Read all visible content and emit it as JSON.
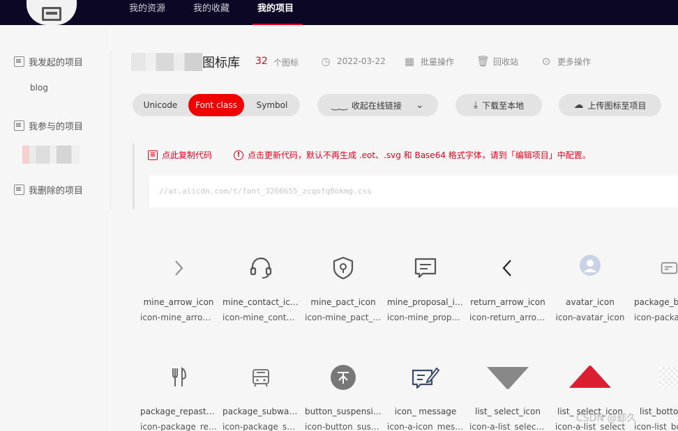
{
  "nav": {
    "items": [
      "我的资源",
      "我的收藏",
      "我的项目"
    ],
    "active_index": 2
  },
  "sidebar": {
    "initiated": "我发起的项目",
    "initiated_sub": "blog",
    "joined": "我参与的项目",
    "deleted": "我删除的项目"
  },
  "header": {
    "title": "图标库",
    "count": "32",
    "count_unit": "个图标",
    "date": "2022-03-22",
    "batch": "批量操作",
    "recycle": "回收站",
    "more": "更多操作"
  },
  "toolbar": {
    "tabs": [
      "Unicode",
      "Font class",
      "Symbol"
    ],
    "active_tab": 1,
    "collapse_link": "收起在线链接",
    "download": "下载至本地",
    "upload": "上传图标至项目"
  },
  "code": {
    "copy": "点此复制代码",
    "update_notice": "点击更新代码，默认不再生成 .eot、.svg 和 Base64 格式字体，请到「编辑项目」中配置。",
    "url": "//at.alicdn.com/t/font_3266655_zcqofq0okmg.css"
  },
  "icons": [
    {
      "name": "mine_arrow_icon",
      "cls": "icon-mine_arrow_icon",
      "icon": "chevron-right-icon"
    },
    {
      "name": "mine_contact_icon",
      "cls": "icon-mine_contact_icon",
      "icon": "headset-icon"
    },
    {
      "name": "mine_pact_icon",
      "cls": "icon-mine_pact_icon",
      "icon": "shield-icon"
    },
    {
      "name": "mine_proposal_icon",
      "cls": "icon-mine_proposal_icon",
      "icon": "chat-icon"
    },
    {
      "name": "return_arrow_icon",
      "cls": "icon-return_arrow_icon",
      "icon": "chevron-left-icon"
    },
    {
      "name": "avatar_icon",
      "cls": "icon-avatar_icon",
      "icon": "avatar-icon"
    },
    {
      "name": "package_b",
      "cls": "icon-packa",
      "icon": "card-icon"
    },
    {
      "name": "package_repast_icon",
      "cls": "icon-package_repast_icon",
      "icon": "fork-knife-icon"
    },
    {
      "name": "package_subway_icon",
      "cls": "icon-package_subway_icon",
      "icon": "subway-icon"
    },
    {
      "name": "button_suspension",
      "cls": "icon-button_suspension",
      "icon": "suspend-button-icon"
    },
    {
      "name": "icon_ message",
      "cls": "icon-a-icon_message",
      "icon": "message-edit-icon"
    },
    {
      "name": "list_ select_icon",
      "cls": "icon-a-list_select_icon",
      "icon": "triangle-down-icon"
    },
    {
      "name": "list_ select_icon",
      "cls": "icon-a-list_select",
      "icon": "triangle-up-icon"
    },
    {
      "name": "list_botto",
      "cls": "icon-list_bo",
      "icon": "checker-icon"
    }
  ],
  "colors": {
    "accent": "#f00000",
    "nav_bg": "#0b0725"
  },
  "watermark": "CSDN @郄久"
}
